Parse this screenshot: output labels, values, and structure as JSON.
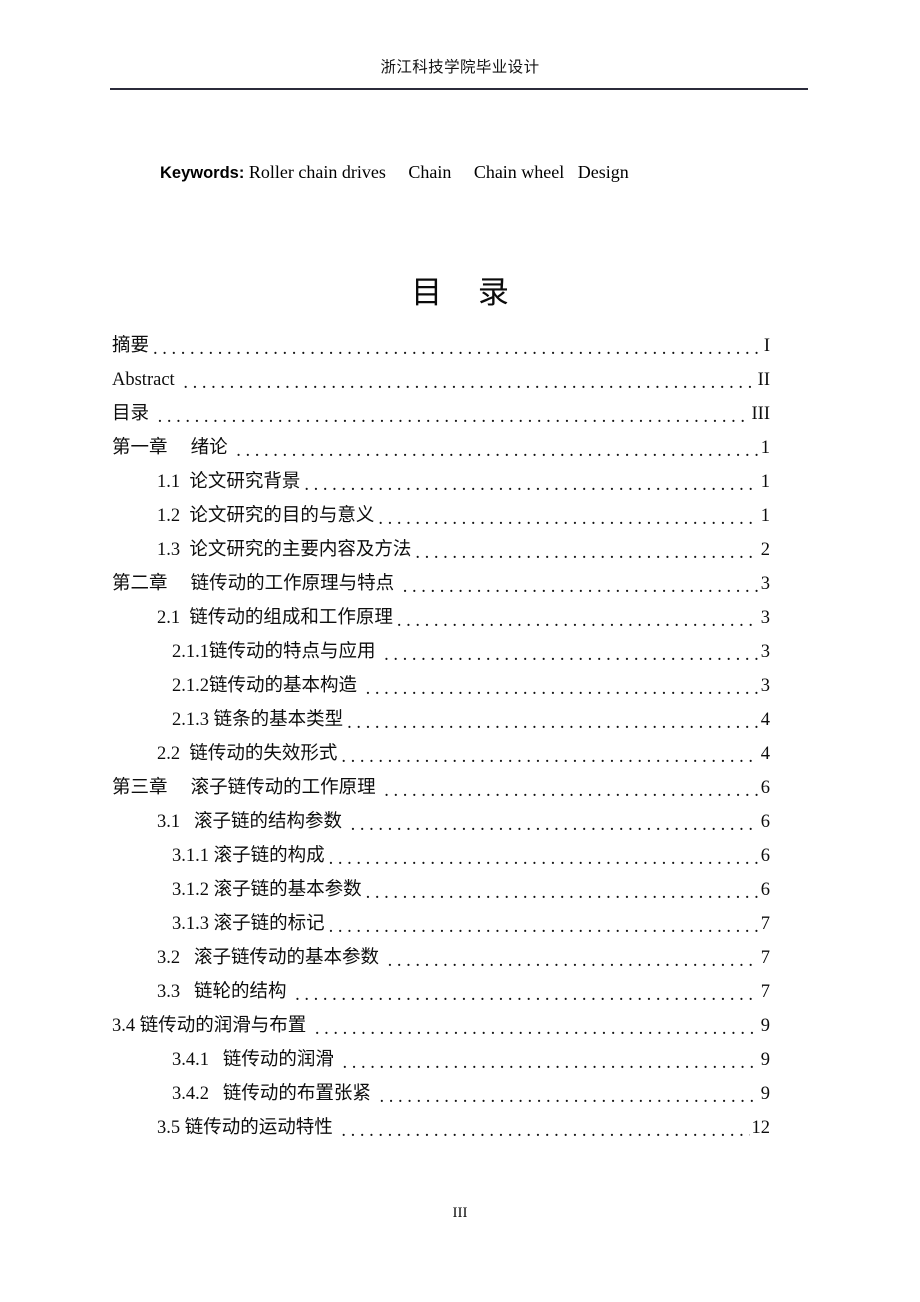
{
  "header": {
    "running_title": "浙江科技学院毕业设计"
  },
  "keywords": {
    "label": "Keywords:",
    "value": " Roller chain drives     Chain     Chain wheel   Design"
  },
  "toc": {
    "title": "目 录",
    "entries": [
      {
        "label": "摘要",
        "page": "I",
        "level": 0
      },
      {
        "label": "Abstract ",
        "page": "II",
        "level": 0
      },
      {
        "label": "目录 ",
        "page": "III",
        "level": 0
      },
      {
        "label": "第一章     绪论 ",
        "page": "1",
        "level": 0
      },
      {
        "label": "1.1  论文研究背景",
        "page": "1",
        "level": 1
      },
      {
        "label": "1.2  论文研究的目的与意义",
        "page": "1",
        "level": 1
      },
      {
        "label": "1.3  论文研究的主要内容及方法",
        "page": "2",
        "level": 1
      },
      {
        "label": "第二章     链传动的工作原理与特点 ",
        "page": "3",
        "level": 0
      },
      {
        "label": "2.1  链传动的组成和工作原理",
        "page": "3",
        "level": 1
      },
      {
        "label": "2.1.1链传动的特点与应用 ",
        "page": "3",
        "level": 2
      },
      {
        "label": "2.1.2链传动的基本构造 ",
        "page": "3",
        "level": 2
      },
      {
        "label": "2.1.3 链条的基本类型",
        "page": "4",
        "level": 2
      },
      {
        "label": "2.2  链传动的失效形式",
        "page": "4",
        "level": 1
      },
      {
        "label": "第三章     滚子链传动的工作原理 ",
        "page": "6",
        "level": 0
      },
      {
        "label": "3.1   滚子链的结构参数 ",
        "page": "6",
        "level": 1
      },
      {
        "label": "3.1.1 滚子链的构成",
        "page": "6",
        "level": 2
      },
      {
        "label": "3.1.2 滚子链的基本参数",
        "page": "6",
        "level": 2
      },
      {
        "label": "3.1.3 滚子链的标记",
        "page": "7",
        "level": 2
      },
      {
        "label": "3.2   滚子链传动的基本参数 ",
        "page": "7",
        "level": 1
      },
      {
        "label": "3.3   链轮的结构 ",
        "page": "7",
        "level": 1
      },
      {
        "label": "3.4 链传动的润滑与布置 ",
        "page": "9",
        "level": 0
      },
      {
        "label": "3.4.1   链传动的润滑 ",
        "page": "9",
        "level": 2
      },
      {
        "label": "3.4.2   链传动的布置张紧 ",
        "page": "9",
        "level": 2
      },
      {
        "label": "3.5 链传动的运动特性 ",
        "page": "12",
        "level": 1
      }
    ]
  },
  "footer": {
    "page_number": "III"
  }
}
